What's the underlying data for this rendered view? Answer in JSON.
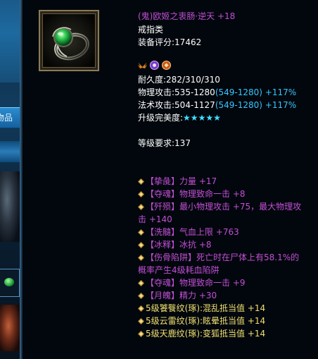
{
  "item": {
    "name": "(鬼)欧姬之衷肠·逆天 +18",
    "category": "戒指类",
    "equip_score": "装备评分:17462",
    "durability": "耐久度:282/310/310",
    "phys_attack_base": "物理攻击:535-1280",
    "phys_attack_range": "(549-1280)",
    "phys_attack_bonus": " +117%",
    "magic_attack_base": "法术攻击:504-1127",
    "magic_attack_range": "(549-1280)",
    "magic_attack_bonus": " +117%",
    "upgrade_label": "升级完美度:",
    "upgrade_stars": "★★★★★",
    "upgrade_star_count": 5,
    "level_req": "等级要求:137"
  },
  "badges": [
    "wings-badge-icon",
    "purple-orb-badge-icon",
    "orange-seal-badge-icon"
  ],
  "attributes": [
    "【挚彘】力量 +17",
    "【夺魂】物理致命一击 +8",
    "【歼殒】最小物理攻击 +75，最大物理攻",
    "击 +140",
    "【洗髓】气血上限 +763",
    "【冰释】冰抗 +8",
    "【伤骨陷阱】死亡时在尸体上有58.1%的",
    "概率产生4级耗血陷阱",
    "【夺魂】物理致命一击 +9",
    "【月魄】精力 +30"
  ],
  "engravings": [
    "5级饕餮纹(琢):混乱抵当值 +14",
    "5级云雷纹(琢):眩晕抵当值 +14",
    "5级天鹿纹(琢):变狐抵当值 +14"
  ],
  "left_strip": {
    "tab_label": "物品"
  },
  "colors": {
    "name": "#c24fd6",
    "attribute": "#c24fd6",
    "range": "#38c6ff",
    "engraving": "#f0e070",
    "star": "#3ee0ff"
  }
}
